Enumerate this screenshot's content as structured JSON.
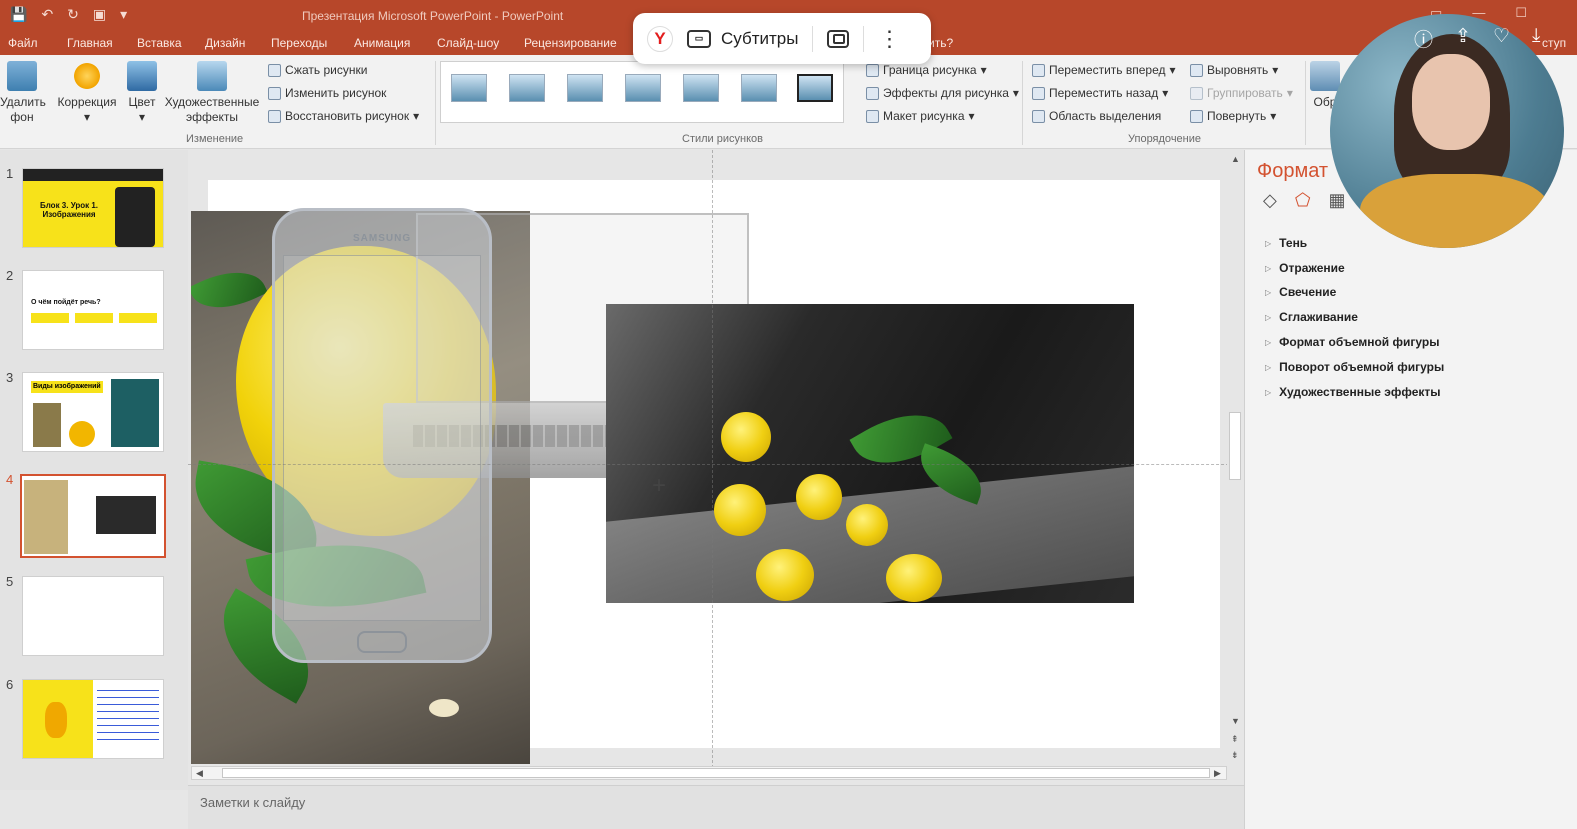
{
  "window": {
    "title": "Презентация Microsoft PowerPoint - PowerPoint"
  },
  "menu_tabs": [
    "Файл",
    "Главная",
    "Вставка",
    "Дизайн",
    "Переходы",
    "Анимация",
    "Слайд-шоу",
    "Рецензирование"
  ],
  "menu_tail": "ступ",
  "menu_partial": "ить?",
  "ribbon": {
    "remove_bg": [
      "Удалить",
      "фон"
    ],
    "correction": "Коррекция",
    "color": "Цвет",
    "art_effects": [
      "Художественные",
      "эффекты"
    ],
    "compress": "Сжать рисунки",
    "change": "Изменить рисунок",
    "reset": "Восстановить рисунок",
    "group_adjust": "Изменение",
    "group_styles": "Стили рисунков",
    "border": "Граница рисунка",
    "effects": "Эффекты для рисунка",
    "layout": "Макет рисунка",
    "bring_forward": "Переместить вперед",
    "send_backward": "Переместить назад",
    "selection_pane": "Область выделения",
    "align": "Выровнять",
    "group": "Группировать",
    "rotate": "Повернуть",
    "group_arrange": "Упорядочение",
    "crop_partial": "Обр"
  },
  "subtitles": {
    "label": "Субтитры"
  },
  "slides": {
    "numbers": [
      "1",
      "2",
      "3",
      "4",
      "5",
      "6"
    ],
    "s1_text": "Блок 3. Урок 1. Изображения",
    "s2_text": "О чём пойдёт речь?",
    "s3_text": "Виды изображений",
    "selected": 4
  },
  "notes": {
    "placeholder": "Заметки к слайду"
  },
  "format_pane": {
    "title": "Формат",
    "items": [
      "Тень",
      "Отражение",
      "Свечение",
      "Сглаживание",
      "Формат объемной фигуры",
      "Поворот объемной фигуры",
      "Художественные эффекты"
    ]
  },
  "phone_brand": "SAMSUNG",
  "colors": {
    "accent": "#b7472a",
    "pane_accent": "#d35230"
  }
}
